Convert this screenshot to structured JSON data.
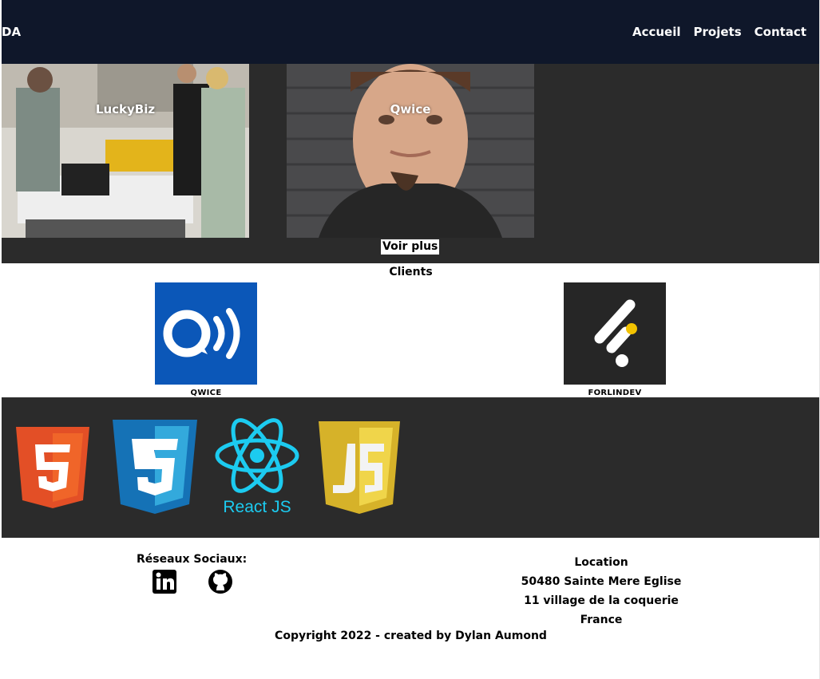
{
  "header": {
    "logo": "DA",
    "nav": [
      "Accueil",
      "Projets",
      "Contact"
    ]
  },
  "projects": {
    "items": [
      {
        "label": "LuckyBiz"
      },
      {
        "label": "Qwice"
      }
    ],
    "more_button": "Voir plus"
  },
  "clients": {
    "title": "Clients",
    "items": [
      {
        "name": "QWICE",
        "icon": "qwice-logo-icon"
      },
      {
        "name": "FORLINDEV",
        "icon": "forlindev-logo-icon"
      }
    ]
  },
  "tech": {
    "items": [
      "html5-icon",
      "css3-icon",
      "react-icon",
      "javascript-icon"
    ],
    "react_label": "React JS"
  },
  "footer": {
    "social_title": "Réseaux Sociaux:",
    "location_title": "Location",
    "location_lines": [
      "50480 Sainte Mere Eglise",
      "11 village de la coquerie",
      "France"
    ],
    "copyright": "Copyright 2022 - created by Dylan Aumond"
  }
}
